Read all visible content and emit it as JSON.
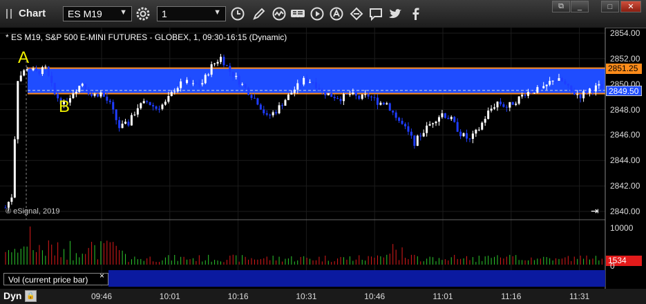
{
  "app": {
    "title": "Chart"
  },
  "toolbar": {
    "symbol": "ES M19",
    "interval": "1",
    "icons": [
      "settings-gear-icon",
      "clock-icon",
      "pencil-draw-icon",
      "study-wave-icon",
      "get-quote-icon",
      "play-icon",
      "alert-icon",
      "link-icon",
      "comment-icon",
      "twitter-icon",
      "facebook-icon"
    ]
  },
  "window_buttons": {
    "icons": [
      "restore-icon",
      "minimize-icon",
      "maximize-icon",
      "close-icon"
    ]
  },
  "chart": {
    "header": "* ES M19, S&P 500 E-MINI FUTURES - GLOBEX, 1, 09:30-16:15 (Dynamic)",
    "watermark": "© eSignal, 2019",
    "annotations": {
      "a": "A",
      "b": "B"
    },
    "price_tags": {
      "upper": "2851.25",
      "current": "2849.50",
      "volume": "1534"
    },
    "colors": {
      "up": "#ffffff",
      "down": "#1f3dff",
      "zone": "#1f4dff",
      "zone_border": "#ff8c1a",
      "vol_up": "#2ecc2e",
      "vol_down": "#e01b1b"
    }
  },
  "status": {
    "label": "Dyn"
  },
  "volume_panel": {
    "label": "Vol (current price bar)",
    "close": "×"
  },
  "chart_data": {
    "type": "candlestick",
    "title": "* ES M19, S&P 500 E-MINI FUTURES - GLOBEX, 1, 09:30-16:15 (Dynamic)",
    "ylim": [
      2840,
      2854
    ],
    "yticks": [
      "2854.00",
      "2852.00",
      "2850.00",
      "2848.00",
      "2846.00",
      "2844.00",
      "2842.00",
      "2840.00"
    ],
    "xticks": [
      "09:46",
      "10:01",
      "10:16",
      "10:31",
      "10:46",
      "11:01",
      "11:16",
      "11:31"
    ],
    "zone": {
      "upper": 2851.25,
      "lower": 2849.25
    },
    "volume": {
      "yticks": [
        "10000",
        "5000",
        "0"
      ],
      "last": 1534
    },
    "close_path": [
      [
        0,
        2840.3
      ],
      [
        2,
        2841.2
      ],
      [
        4,
        2850.4
      ],
      [
        7,
        2851.3
      ],
      [
        10,
        2850.9
      ],
      [
        13,
        2851.2
      ],
      [
        16,
        2849.2
      ],
      [
        19,
        2848.4
      ],
      [
        22,
        2849.4
      ],
      [
        25,
        2850.1
      ],
      [
        28,
        2849.1
      ],
      [
        31,
        2849.3
      ],
      [
        34,
        2848.4
      ],
      [
        37,
        2846.6
      ],
      [
        40,
        2846.9
      ],
      [
        43,
        2848.2
      ],
      [
        46,
        2848.6
      ],
      [
        49,
        2848.1
      ],
      [
        52,
        2848.5
      ],
      [
        55,
        2849.6
      ],
      [
        58,
        2850.2
      ],
      [
        61,
        2849.9
      ],
      [
        64,
        2850.1
      ],
      [
        67,
        2851.4
      ],
      [
        70,
        2852.1
      ],
      [
        73,
        2851.0
      ],
      [
        76,
        2850.2
      ],
      [
        79,
        2849.4
      ],
      [
        82,
        2848.6
      ],
      [
        85,
        2847.4
      ],
      [
        88,
        2847.9
      ],
      [
        91,
        2848.8
      ],
      [
        94,
        2849.6
      ],
      [
        97,
        2850.3
      ],
      [
        100,
        2850.2
      ],
      [
        103,
        2849.4
      ],
      [
        106,
        2849.1
      ],
      [
        109,
        2848.9
      ],
      [
        112,
        2849.2
      ],
      [
        115,
        2848.9
      ],
      [
        118,
        2849.1
      ],
      [
        121,
        2848.6
      ],
      [
        124,
        2848.5
      ],
      [
        127,
        2847.4
      ],
      [
        130,
        2846.5
      ],
      [
        133,
        2845.4
      ],
      [
        136,
        2846.3
      ],
      [
        139,
        2847.1
      ],
      [
        142,
        2847.7
      ],
      [
        145,
        2847.2
      ],
      [
        148,
        2846.1
      ],
      [
        151,
        2845.6
      ],
      [
        154,
        2846.5
      ],
      [
        157,
        2847.8
      ],
      [
        160,
        2848.6
      ],
      [
        163,
        2848.2
      ],
      [
        166,
        2848.7
      ],
      [
        169,
        2849.3
      ],
      [
        172,
        2849.5
      ],
      [
        175,
        2849.6
      ],
      [
        178,
        2850.4
      ],
      [
        181,
        2850.2
      ],
      [
        184,
        2849.4
      ],
      [
        187,
        2849.1
      ],
      [
        190,
        2849.6
      ],
      [
        193,
        2849.8
      ],
      [
        195,
        2849.5
      ]
    ]
  }
}
